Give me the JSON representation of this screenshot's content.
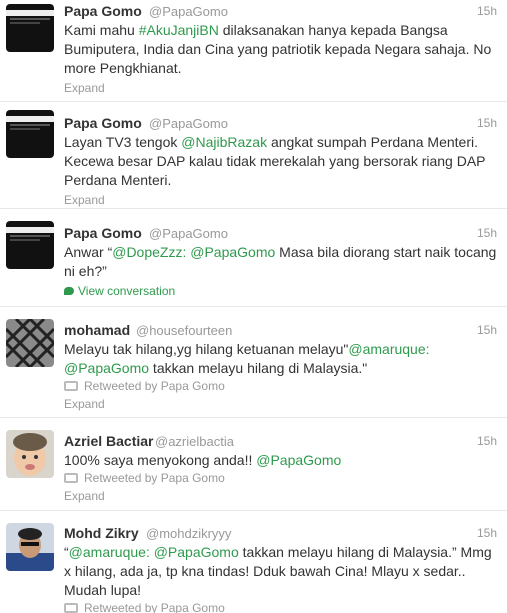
{
  "tweets": [
    {
      "fullname": "Papa Gomo",
      "username": "@PapaGomo",
      "time": "15h",
      "avatar": "dark-banner-avatar",
      "text_parts": [
        {
          "t": "Kami mahu ",
          "k": "plain"
        },
        {
          "t": "#AkuJanjiBN",
          "k": "hash"
        },
        {
          "t": " dilaksanakan hanya kepada Bangsa Bumiputera, India dan Cina yang patriotik kepada Negara sahaja. No more Pengkhianat.",
          "k": "plain"
        }
      ],
      "action": "Expand"
    },
    {
      "fullname": "Papa Gomo",
      "username": "@PapaGomo",
      "time": "15h",
      "avatar": "dark-banner-avatar",
      "text_parts": [
        {
          "t": "Layan TV3 tengok ",
          "k": "plain"
        },
        {
          "t": "@NajibRazak",
          "k": "mention"
        },
        {
          "t": " angkat sumpah Perdana Menteri. Kecewa besar DAP kalau tidak merekalah yang bersorak riang DAP Perdana Menteri.",
          "k": "plain"
        }
      ],
      "action": "Expand"
    },
    {
      "fullname": "Papa Gomo",
      "username": "@PapaGomo",
      "time": "15h",
      "avatar": "dark-banner-avatar",
      "text_parts": [
        {
          "t": "Anwar “",
          "k": "plain"
        },
        {
          "t": "@DopeZzz",
          "k": "mention"
        },
        {
          "t": ": ",
          "k": "mention"
        },
        {
          "t": "@PapaGomo",
          "k": "mention"
        },
        {
          "t": " Masa bila diorang start naik tocang ni eh?”",
          "k": "plain"
        }
      ],
      "action": "View conversation"
    },
    {
      "fullname": "mohamad",
      "username": "@housefourteen",
      "time": "15h",
      "avatar": "grid-avatar",
      "text_parts": [
        {
          "t": "Melayu tak hilang,yg hilang ketuanan melayu\"",
          "k": "plain"
        },
        {
          "t": "@amaruque",
          "k": "mention"
        },
        {
          "t": ": ",
          "k": "mention"
        },
        {
          "t": "@PapaGomo",
          "k": "mention"
        },
        {
          "t": " takkan melayu hilang di Malaysia.\"",
          "k": "plain"
        }
      ],
      "retweeted_by": "Retweeted by Papa Gomo",
      "action": "Expand"
    },
    {
      "fullname": "Azriel Bactiar",
      "username": "@azrielbactia",
      "time": "15h",
      "avatar": "baby-avatar",
      "text_parts": [
        {
          "t": "100% saya menyokong anda!! ",
          "k": "plain"
        },
        {
          "t": "@PapaGomo",
          "k": "mention"
        }
      ],
      "retweeted_by": "Retweeted by Papa Gomo",
      "action": "Expand"
    },
    {
      "fullname": "Mohd Zikry",
      "username": "@mohdzikryyy",
      "time": "15h",
      "avatar": "person-avatar",
      "text_parts": [
        {
          "t": "“",
          "k": "plain"
        },
        {
          "t": "@amaruque",
          "k": "mention"
        },
        {
          "t": ": ",
          "k": "mention"
        },
        {
          "t": "@PapaGomo",
          "k": "mention"
        },
        {
          "t": " takkan melayu hilang di Malaysia.” Mmg x hilang, ada ja, tp kna tindas! Dduk bawah Cina! Mlayu x sedar.. Mudah lupa!",
          "k": "plain"
        }
      ],
      "retweeted_by": "Retweeted by Papa Gomo"
    }
  ],
  "colors": {
    "link": "#2f9a4d",
    "muted": "#999999",
    "text": "#333333"
  }
}
